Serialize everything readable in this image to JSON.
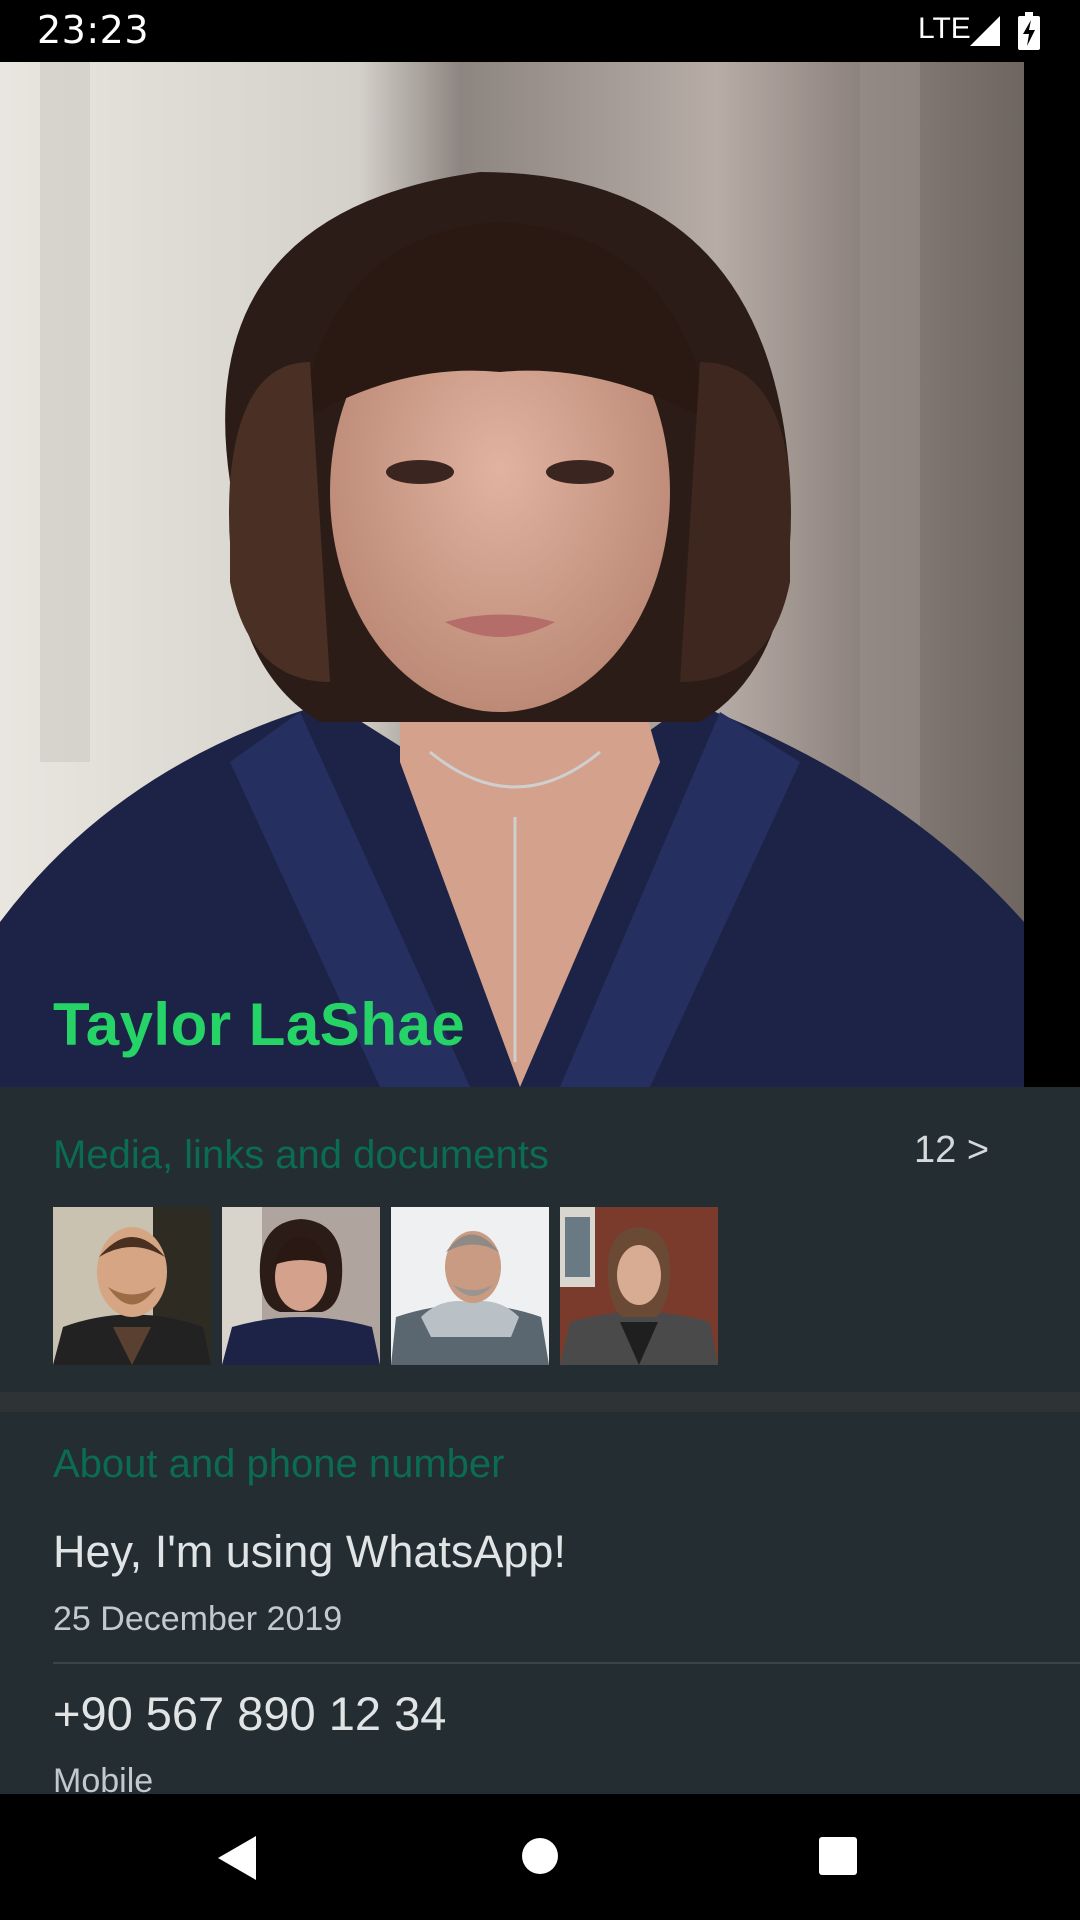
{
  "status_bar": {
    "time": "23:23",
    "network": "LTE",
    "icons": [
      "signal-icon",
      "battery-charging-icon"
    ]
  },
  "profile": {
    "name": "Taylor LaShae",
    "name_color": "#25d366"
  },
  "media": {
    "title": "Media, links and documents",
    "count": "12 >",
    "thumbnails": [
      "man-smiling-photo",
      "woman-bob-haircut-photo",
      "older-man-fur-coat-photo",
      "woman-coat-brick-wall-photo"
    ]
  },
  "about": {
    "title": "About and phone number",
    "status_text": "Hey, I'm using WhatsApp!",
    "status_date": "25 December 2019",
    "phone": "+90 567 890 12 34",
    "phone_type": "Mobile"
  },
  "nav": {
    "icons": [
      "back-icon",
      "home-icon",
      "recents-icon"
    ]
  },
  "colors": {
    "accent": "#25d366",
    "section_title": "#0b6b55",
    "section_bg": "#232d32"
  }
}
